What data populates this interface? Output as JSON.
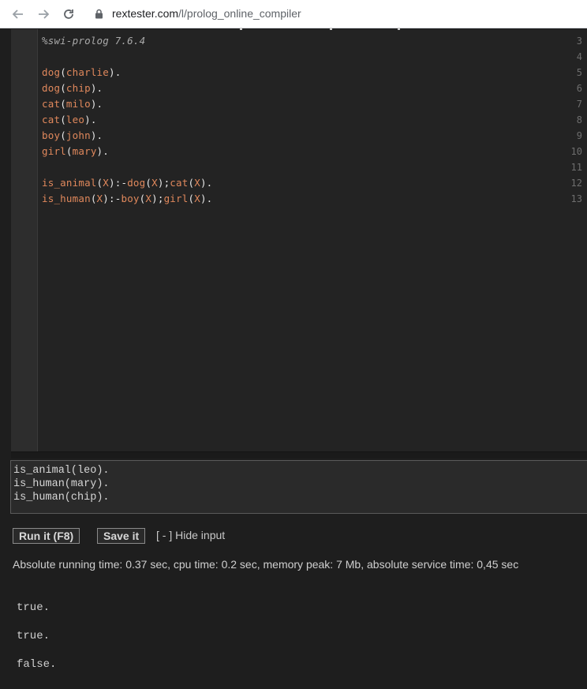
{
  "browser": {
    "url_host": "rextester.com",
    "url_path": "/l/prolog_online_compiler"
  },
  "editor": {
    "lines": [
      {
        "num": "3",
        "text": "%swi-prolog 7.6.4"
      },
      {
        "num": "4",
        "text": ""
      },
      {
        "num": "5",
        "text": "dog(charlie)."
      },
      {
        "num": "6",
        "text": "dog(chip)."
      },
      {
        "num": "7",
        "text": "cat(milo)."
      },
      {
        "num": "8",
        "text": "cat(leo)."
      },
      {
        "num": "9",
        "text": "boy(john)."
      },
      {
        "num": "10",
        "text": "girl(mary)."
      },
      {
        "num": "11",
        "text": ""
      },
      {
        "num": "12",
        "text": "is_animal(X):-dog(X);cat(X)."
      },
      {
        "num": "13",
        "text": "is_human(X):-boy(X);girl(X)."
      }
    ]
  },
  "input": {
    "lines": [
      "is_animal(leo).",
      "is_human(mary).",
      "is_human(chip)."
    ]
  },
  "actions": {
    "run_label": "Run it (F8)",
    "save_label": "Save it",
    "hide_input_label": "[ - ] Hide input"
  },
  "stats": "Absolute running time: 0.37 sec, cpu time: 0.2 sec, memory peak: 7 Mb, absolute service time: 0,45 sec",
  "output": {
    "lines": [
      "true.",
      "true.",
      "false."
    ]
  }
}
